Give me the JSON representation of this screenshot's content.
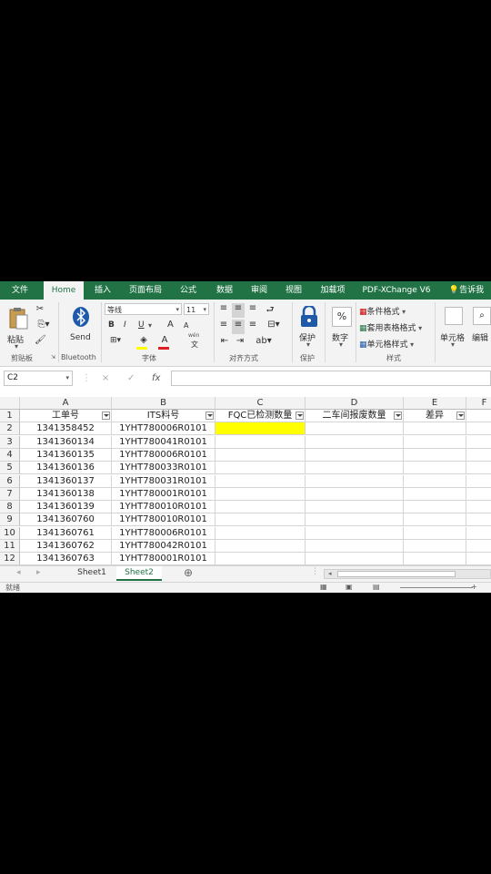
{
  "tabs": [
    "文件",
    "Home",
    "插入",
    "页面布局",
    "公式",
    "数据",
    "审阅",
    "视图",
    "加载项",
    "PDF-XChange V6",
    "告诉我"
  ],
  "ribbon": {
    "paste": "粘贴",
    "send": "Send",
    "font_name": "等线",
    "font_size": "11",
    "bold": "B",
    "italic": "I",
    "underline": "U",
    "grow_font": "A",
    "shrink_font": "A",
    "font_color": "A",
    "wen": "wén",
    "wen_char": "文",
    "protect": "保护",
    "number": "数字",
    "percent": "%",
    "cond_format": "条件格式",
    "table_format": "套用表格格式",
    "cell_style": "单元格样式",
    "cells": "单元格",
    "edit": "编辑",
    "groups": {
      "clipboard": "剪贴板",
      "bluetooth": "Bluetooth",
      "font": "字体",
      "align": "对齐方式",
      "protect": "保护",
      "style": "样式"
    }
  },
  "formula_bar": {
    "name_box": "C2",
    "cancel": "×",
    "confirm": "✓",
    "fx": "fx",
    "value": ""
  },
  "sheet": {
    "columns": [
      "A",
      "B",
      "C",
      "D",
      "E",
      "F"
    ],
    "headers": [
      "工单号",
      "ITS料号",
      "FQC已检测数量",
      "二车间报废数量",
      "差异"
    ],
    "row_numbers": [
      "1",
      "2",
      "3",
      "4",
      "5",
      "6",
      "7",
      "8",
      "9",
      "10",
      "11",
      "12"
    ],
    "rows": [
      [
        "1341358452",
        "1YHT780006R0101"
      ],
      [
        "1341360134",
        "1YHT780041R0101"
      ],
      [
        "1341360135",
        "1YHT780006R0101"
      ],
      [
        "1341360136",
        "1YHT780033R0101"
      ],
      [
        "1341360137",
        "1YHT780031R0101"
      ],
      [
        "1341360138",
        "1YHT780001R0101"
      ],
      [
        "1341360139",
        "1YHT780010R0101"
      ],
      [
        "1341360760",
        "1YHT780010R0101"
      ],
      [
        "1341360761",
        "1YHT780006R0101"
      ],
      [
        "1341360762",
        "1YHT780042R0101"
      ],
      [
        "1341360763",
        "1YHT780001R0101"
      ]
    ],
    "selected_cell": "C2",
    "selected_fill": "#ffff00"
  },
  "sheet_tabs": [
    "Sheet1",
    "Sheet2"
  ],
  "active_sheet": "Sheet2",
  "status": "就绪",
  "colors": {
    "accent": "#217346",
    "ribbon_bg": "#f3f3f3"
  }
}
